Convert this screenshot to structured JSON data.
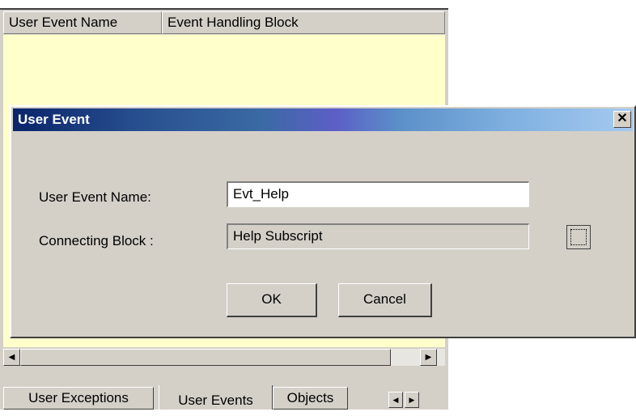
{
  "list": {
    "columns": [
      "User Event Name",
      "Event Handling Block"
    ]
  },
  "scroll": {
    "left_arrow": "◀",
    "right_arrow": "▶"
  },
  "tabs": {
    "items": [
      "User Exceptions",
      "User Events",
      "Objects"
    ],
    "active": "User Events"
  },
  "dialog": {
    "title": "User Event",
    "close_label": "✕",
    "event_name_label": "User Event Name:",
    "event_name_value": "Evt_Help",
    "connecting_block_label": "Connecting Block :",
    "connecting_block_value": "Help Subscript",
    "ok_label": "OK",
    "cancel_label": "Cancel"
  },
  "colors": {
    "list_background": "#ffffcc",
    "title_gradient_start": "#0a246a",
    "title_gradient_end": "#a6caf0",
    "face": "#d4d0c8"
  },
  "icons": {
    "browse": "ellipsis-browse-icon",
    "close": "close-icon",
    "scroll_left": "arrow-left-icon",
    "scroll_right": "arrow-right-icon"
  }
}
